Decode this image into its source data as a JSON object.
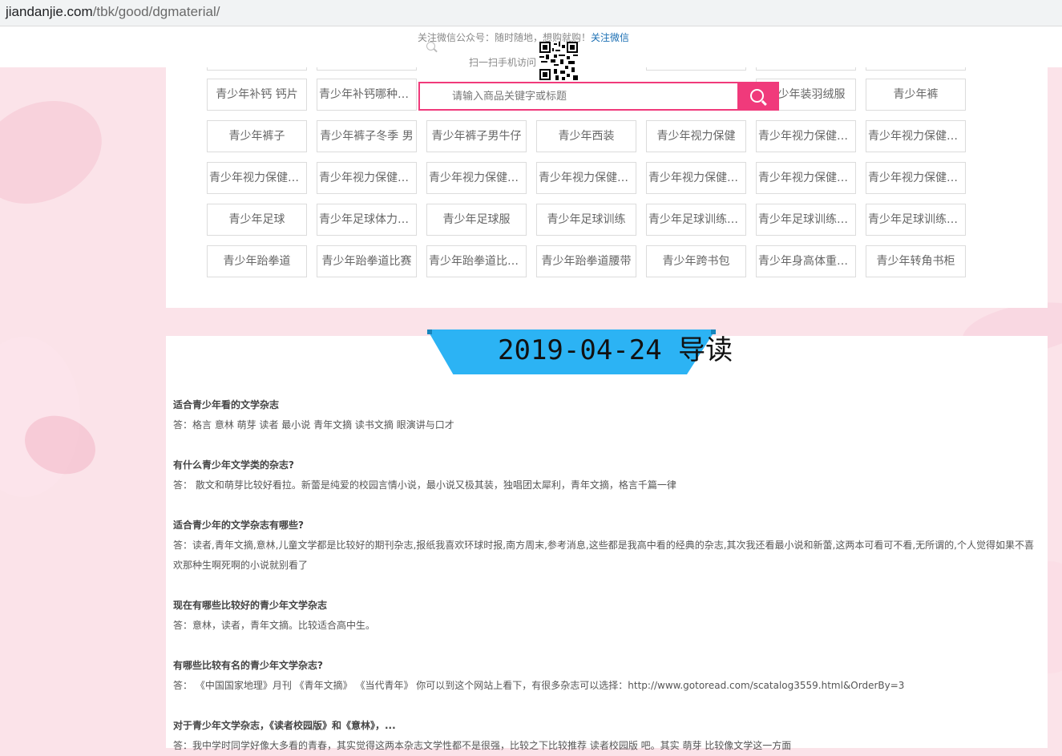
{
  "browser": {
    "url_host": "jiandanjie.com",
    "url_path": "/tbk/good/dgmaterial/"
  },
  "header": {
    "wechat_text": "关注微信公众号：随时随地，想购就购！",
    "wechat_link": "关注微信",
    "scan_text": "扫一扫手机访问"
  },
  "search": {
    "placeholder": "请输入商品关键字或标题"
  },
  "tags": [
    [
      "青少年补钙 钙片",
      "青少年补钙哪种钙好",
      "",
      "",
      "",
      "青少年装羽绒服",
      "青少年裤"
    ],
    [
      "青少年裤子",
      "青少年裤子冬季 男",
      "青少年裤子男牛仔",
      "青少年西装",
      "青少年视力保健",
      "青少年视力保健加盟",
      "青少年视力保健加盟店"
    ],
    [
      "青少年视力保健加盟费",
      "青少年视力保健品牌",
      "青少年视力保健康复",
      "青少年视力保健招商",
      "青少年视力保健机构",
      "青少年视力保健知识",
      "青少年视力保健连锁"
    ],
    [
      "青少年足球",
      "青少年足球体力训练",
      "青少年足球服",
      "青少年足球训练",
      "青少年足球训练基地",
      "青少年足球训练方法",
      "青少年足球训练视频"
    ],
    [
      "青少年跆拳道",
      "青少年跆拳道比赛",
      "青少年跆拳道比赛视频",
      "青少年跆拳道腰带",
      "青少年跨书包",
      "青少年身高体重计算",
      "青少年转角书柜"
    ]
  ],
  "banner": {
    "date": "2019-04-24 导读"
  },
  "qa": [
    {
      "q": "适合青少年看的文学杂志",
      "a": "答：格言 意林 萌芽 读者 最小说 青年文摘 读书文摘 眼演讲与口才"
    },
    {
      "q": "有什么青少年文学类的杂志?",
      "a": "答： 散文和萌芽比较好看拉。新蕾是纯爱的校园言情小说，最小说又极其装，独唱团太犀利，青年文摘，格言千篇一律"
    },
    {
      "q": "适合青少年的文学杂志有哪些?",
      "a": "答：读者,青年文摘,意林,儿童文学都是比较好的期刊杂志,报纸我喜欢环球时报,南方周末,参考消息,这些都是我高中看的经典的杂志,其次我还看最小说和新蕾,这两本可看可不看,无所谓的,个人觉得如果不喜欢那种生啊死啊的小说就别看了"
    },
    {
      "q": "现在有哪些比较好的青少年文学杂志",
      "a": "答：意林，读者，青年文摘。比较适合高中生。"
    },
    {
      "q": "有哪些比较有名的青少年文学杂志?",
      "a": "答： 《中国国家地理》月刊 《青年文摘》 《当代青年》 你可以到这个网站上看下，有很多杂志可以选择：http://www.gotoread.com/scatalog3559.html&OrderBy=3"
    },
    {
      "q": "对于青少年文学杂志，《读者校园版》和《意林》，...",
      "a": "答：我中学时同学好像大多看的青春，其实觉得这两本杂志文学性都不是很强，比较之下比较推荐 读者校园版 吧。其实 萌芽 比较像文学这一方面"
    }
  ],
  "colors": {
    "accent": "#f03a7b",
    "banner": "#2cb3f4"
  }
}
